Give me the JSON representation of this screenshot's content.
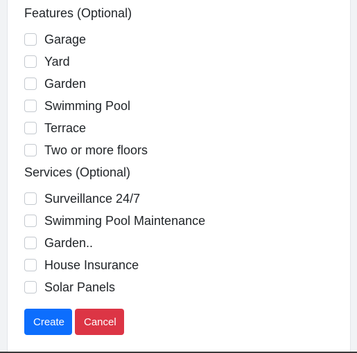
{
  "features": {
    "title": "Features (Optional)",
    "items": [
      {
        "label": "Garage",
        "checked": false
      },
      {
        "label": "Yard",
        "checked": false
      },
      {
        "label": "Garden",
        "checked": false
      },
      {
        "label": "Swimming Pool",
        "checked": false
      },
      {
        "label": "Terrace",
        "checked": false
      },
      {
        "label": "Two or more floors",
        "checked": false
      }
    ]
  },
  "services": {
    "title": "Services (Optional)",
    "items": [
      {
        "label": "Surveillance 24/7",
        "checked": false
      },
      {
        "label": "Swimming Pool Maintenance",
        "checked": false
      },
      {
        "label": "Garden..",
        "checked": false
      },
      {
        "label": "House Insurance",
        "checked": false
      },
      {
        "label": "Solar Panels",
        "checked": false
      }
    ]
  },
  "actions": {
    "create_label": "Create",
    "cancel_label": "Cancel"
  },
  "colors": {
    "primary": "#0d6efd",
    "danger": "#dc3545",
    "text": "#212529",
    "checkbox_border": "#c4c9cf"
  }
}
